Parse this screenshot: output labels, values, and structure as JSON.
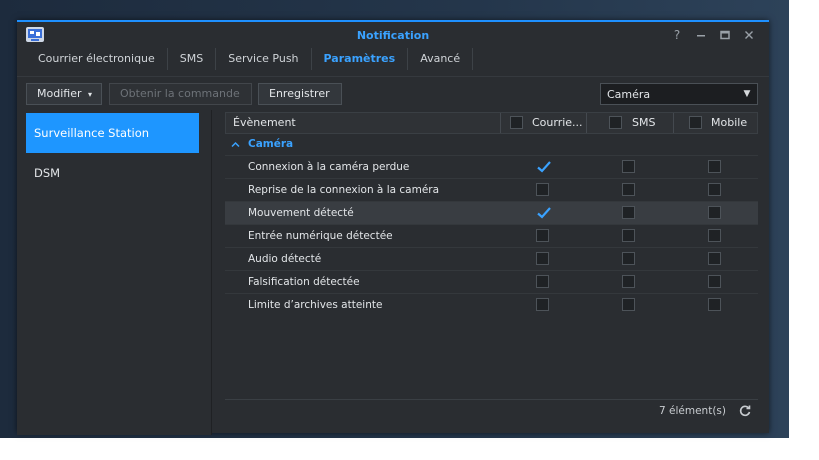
{
  "window": {
    "title": "Notification"
  },
  "tabs": [
    {
      "label": "Courrier électronique",
      "active": false
    },
    {
      "label": "SMS",
      "active": false
    },
    {
      "label": "Service Push",
      "active": false
    },
    {
      "label": "Paramètres",
      "active": true
    },
    {
      "label": "Avancé",
      "active": false
    }
  ],
  "toolbar": {
    "modifier_label": "Modifier",
    "obtenir_label": "Obtenir la commande",
    "enregistrer_label": "Enregistrer",
    "filter_value": "Caméra"
  },
  "sidebar": {
    "items": [
      {
        "label": "Surveillance Station",
        "active": true
      },
      {
        "label": "DSM",
        "active": false
      }
    ]
  },
  "grid": {
    "columns": {
      "event": "Évènement",
      "email": "Courrie...",
      "sms": "SMS",
      "mobile": "Mobile"
    },
    "group": "Caméra",
    "rows": [
      {
        "label": "Connexion à la caméra perdue",
        "email": true,
        "sms": false,
        "mobile": false
      },
      {
        "label": "Reprise de la connexion à la caméra",
        "email": false,
        "sms": false,
        "mobile": false
      },
      {
        "label": "Mouvement détecté",
        "email": true,
        "sms": false,
        "mobile": false,
        "highlight": true
      },
      {
        "label": "Entrée numérique détectée",
        "email": false,
        "sms": false,
        "mobile": false
      },
      {
        "label": "Audio détecté",
        "email": false,
        "sms": false,
        "mobile": false
      },
      {
        "label": "Falsification détectée",
        "email": false,
        "sms": false,
        "mobile": false
      },
      {
        "label": "Limite d’archives atteinte",
        "email": false,
        "sms": false,
        "mobile": false
      }
    ],
    "footer_count": "7 élément(s)"
  },
  "colors": {
    "accent": "#1e96ff",
    "window_bg": "#2a2d31",
    "check": "#3aa2ff"
  }
}
